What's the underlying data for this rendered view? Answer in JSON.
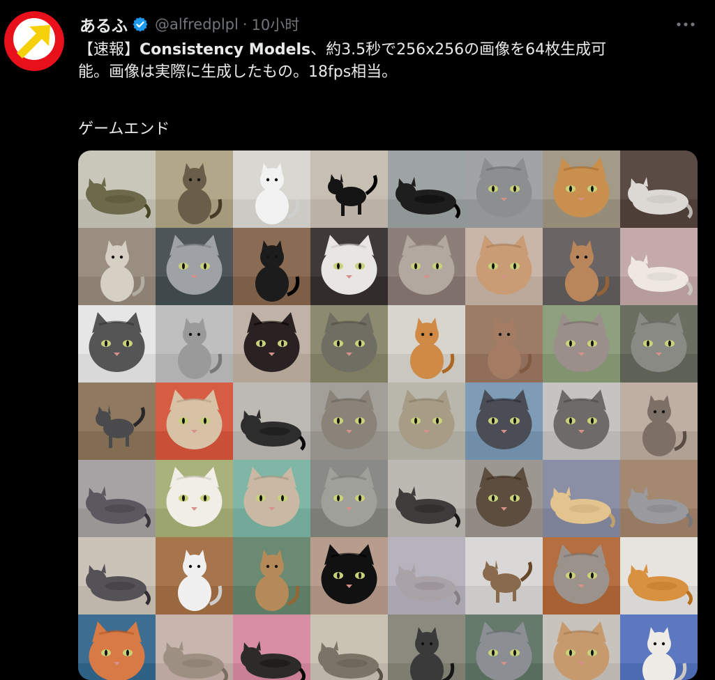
{
  "tweet": {
    "display_name": "あるふ",
    "handle": "@alfredplpl",
    "separator": "·",
    "time": "10小时",
    "text": {
      "bracket_open": "【速報】",
      "bold": "Consistency Models",
      "rest_line1": "、約3.5秒で256x256の画像を64枚生成可",
      "line2": "能。画像は実際に生成したもの。18fps相当。",
      "line3": "ゲームエンド"
    }
  },
  "avatar": {
    "icon": "arrow-up-right-icon",
    "colors": {
      "ring": "#e8111b",
      "inner": "#ffffff",
      "arrow": "#f6d10a"
    }
  },
  "colors": {
    "background": "#000000",
    "text": "#e7e9ea",
    "muted": "#71767b",
    "verified": "#1d9bf0"
  },
  "media": {
    "description_icon": "image-grid-icon",
    "columns": 8,
    "rows": 7,
    "tiles": [
      {
        "bg": "#c9c7b9",
        "cat": "#6d6a4c",
        "shape": "lying"
      },
      {
        "bg": "#b3a78a",
        "cat": "#6a5d4a",
        "shape": "sitting"
      },
      {
        "bg": "#d9d7d2",
        "cat": "#f2f2f2",
        "shape": "sitting"
      },
      {
        "bg": "#c8bfb3",
        "cat": "#141414",
        "shape": "walking"
      },
      {
        "bg": "#9ea3a3",
        "cat": "#1e1e1e",
        "shape": "lying"
      },
      {
        "bg": "#a1a3a5",
        "cat": "#8d8e90",
        "shape": "face"
      },
      {
        "bg": "#a39a88",
        "cat": "#c88f4e",
        "shape": "face"
      },
      {
        "bg": "#5a4c44",
        "cat": "#dcd9d4",
        "shape": "lying"
      },
      {
        "bg": "#9a8e80",
        "cat": "#d6cfc4",
        "shape": "sitting"
      },
      {
        "bg": "#4d5559",
        "cat": "#9ea2a7",
        "shape": "face"
      },
      {
        "bg": "#8a6b53",
        "cat": "#1c1c1c",
        "shape": "sitting"
      },
      {
        "bg": "#3f3a38",
        "cat": "#e8e6e2",
        "shape": "face"
      },
      {
        "bg": "#8c7e79",
        "cat": "#b3a89f",
        "shape": "face"
      },
      {
        "bg": "#c8b7a8",
        "cat": "#c99c76",
        "shape": "face"
      },
      {
        "bg": "#6a6464",
        "cat": "#b8865a",
        "shape": "sitting"
      },
      {
        "bg": "#c4aaa8",
        "cat": "#efe8e2",
        "shape": "lying"
      },
      {
        "bg": "#e6e6e6",
        "cat": "#555555",
        "shape": "face"
      },
      {
        "bg": "#bfbfbf",
        "cat": "#9a9a9a",
        "shape": "sitting"
      },
      {
        "bg": "#c0b2a6",
        "cat": "#2a2222",
        "shape": "face"
      },
      {
        "bg": "#8d8b6f",
        "cat": "#6f6e62",
        "shape": "face"
      },
      {
        "bg": "#d8d4ce",
        "cat": "#cf8a45",
        "shape": "sitting"
      },
      {
        "bg": "#9d7c66",
        "cat": "#a47c63",
        "shape": "sitting"
      },
      {
        "bg": "#8fa07e",
        "cat": "#9a8f8b",
        "shape": "face"
      },
      {
        "bg": "#6b6f62",
        "cat": "#8a8a84",
        "shape": "face"
      },
      {
        "bg": "#8f7a60",
        "cat": "#4a4a4c",
        "shape": "walking"
      },
      {
        "bg": "#d65c44",
        "cat": "#d8c2a6",
        "shape": "face"
      },
      {
        "bg": "#bdb9b4",
        "cat": "#2d2d2d",
        "shape": "lying"
      },
      {
        "bg": "#a29e98",
        "cat": "#8a8379",
        "shape": "face"
      },
      {
        "bg": "#b9b7ac",
        "cat": "#a79d86",
        "shape": "face"
      },
      {
        "bg": "#7e9cb5",
        "cat": "#4a4d55",
        "shape": "face"
      },
      {
        "bg": "#c6c4c3",
        "cat": "#6d6a67",
        "shape": "face"
      },
      {
        "bg": "#bfaea2",
        "cat": "#7c7066",
        "shape": "sitting"
      },
      {
        "bg": "#a7a3a4",
        "cat": "#5b5860",
        "shape": "lying"
      },
      {
        "bg": "#a8b27a",
        "cat": "#f0eee6",
        "shape": "face"
      },
      {
        "bg": "#7fb6a6",
        "cat": "#c9b9a4",
        "shape": "face"
      },
      {
        "bg": "#8a8a86",
        "cat": "#a0a09a",
        "shape": "face"
      },
      {
        "bg": "#bcb8b2",
        "cat": "#3e3c3a",
        "shape": "lying"
      },
      {
        "bg": "#9d9791",
        "cat": "#5d4d3e",
        "shape": "face"
      },
      {
        "bg": "#8b8fa6",
        "cat": "#e3c48f",
        "shape": "lying"
      },
      {
        "bg": "#a4886f",
        "cat": "#9a9a9e",
        "shape": "lying"
      },
      {
        "bg": "#cbc3b8",
        "cat": "#555257",
        "shape": "lying"
      },
      {
        "bg": "#a7754c",
        "cat": "#f0f0f0",
        "shape": "sitting"
      },
      {
        "bg": "#6b8a74",
        "cat": "#b48a58",
        "shape": "sitting"
      },
      {
        "bg": "#b89d8f",
        "cat": "#111111",
        "shape": "face"
      },
      {
        "bg": "#b7b3bc",
        "cat": "#a9a2a7",
        "shape": "lying"
      },
      {
        "bg": "#d9d8d6",
        "cat": "#8a6a4c",
        "shape": "walking"
      },
      {
        "bg": "#b56e3f",
        "cat": "#9b928c",
        "shape": "face"
      },
      {
        "bg": "#e7e4e0",
        "cat": "#d8913f",
        "shape": "lying"
      },
      {
        "bg": "#3d6e91",
        "cat": "#d77a46",
        "shape": "face"
      },
      {
        "bg": "#c8b5ad",
        "cat": "#9d8f82",
        "shape": "lying"
      },
      {
        "bg": "#d78ea2",
        "cat": "#2d2a2a",
        "shape": "lying"
      },
      {
        "bg": "#c9c3b4",
        "cat": "#7b7366",
        "shape": "lying"
      },
      {
        "bg": "#8a8a7e",
        "cat": "#3a3a3a",
        "shape": "sitting"
      },
      {
        "bg": "#667a6b",
        "cat": "#8b8f93",
        "shape": "face"
      },
      {
        "bg": "#c8c3bc",
        "cat": "#c79a6e",
        "shape": "face"
      },
      {
        "bg": "#5b78c0",
        "cat": "#efece7",
        "shape": "sitting"
      }
    ]
  }
}
